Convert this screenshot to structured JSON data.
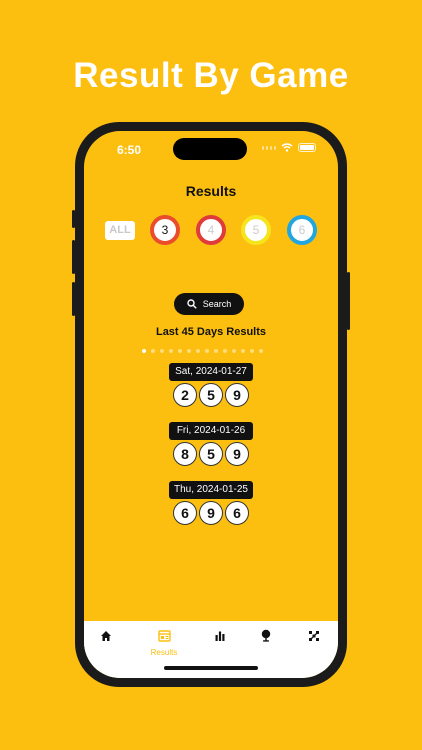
{
  "promo": {
    "title": "Result By Game"
  },
  "status_bar": {
    "time": "6:50"
  },
  "app": {
    "title": "Results"
  },
  "filters": {
    "all_label": "ALL",
    "games": [
      {
        "label": "3",
        "ring_color": "#e94d2c",
        "text_color": "#111111"
      },
      {
        "label": "4",
        "ring_color": "#e03b3b",
        "text_color": "#cccccc"
      },
      {
        "label": "5",
        "ring_color": "#f6e51d",
        "text_color": "#cccccc"
      },
      {
        "label": "6",
        "ring_color": "#22a6e0",
        "text_color": "#cccccc"
      }
    ]
  },
  "search": {
    "label": "Search"
  },
  "section": {
    "title": "Last 45 Days Results"
  },
  "pagination": {
    "total": 14,
    "active_index": 0
  },
  "draws": [
    {
      "date": "Sat, 2024-01-27",
      "numbers": [
        "2",
        "5",
        "9"
      ]
    },
    {
      "date": "Fri, 2024-01-26",
      "numbers": [
        "8",
        "5",
        "9"
      ]
    },
    {
      "date": "Thu, 2024-01-25",
      "numbers": [
        "6",
        "9",
        "6"
      ]
    }
  ],
  "tab_bar": {
    "items": [
      {
        "name": "home",
        "icon": "home-icon",
        "label": ""
      },
      {
        "name": "results",
        "icon": "results-icon",
        "label": "Results",
        "active": true
      },
      {
        "name": "stats",
        "icon": "bar-chart-icon",
        "label": ""
      },
      {
        "name": "predict",
        "icon": "crystal-ball-icon",
        "label": ""
      },
      {
        "name": "tools",
        "icon": "grid-tool-icon",
        "label": ""
      }
    ]
  },
  "colors": {
    "background": "#FDBF0F",
    "accent_dark": "#111111"
  }
}
